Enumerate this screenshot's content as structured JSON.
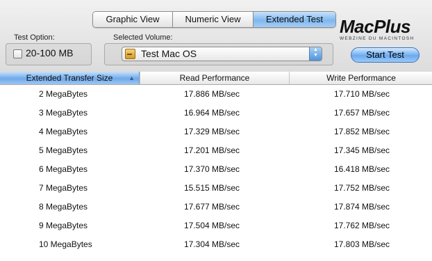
{
  "tabs": [
    {
      "label": "Graphic View",
      "active": false
    },
    {
      "label": "Numeric View",
      "active": false
    },
    {
      "label": "Extended Test",
      "active": true
    }
  ],
  "test_option": {
    "label": "Test Option:",
    "checkbox_label": "20-100 MB",
    "checked": false
  },
  "volume": {
    "label": "Selected Volume:",
    "selected": "Test Mac OS"
  },
  "logo": {
    "main": "MacPlus",
    "sub": "WEBZINE DU MACINTOSH"
  },
  "start_button": "Start Test",
  "table": {
    "headers": [
      "Extended Transfer Size",
      "Read Performance",
      "Write Performance"
    ],
    "rows": [
      [
        "2 MegaBytes",
        "17.886 MB/sec",
        "17.710 MB/sec"
      ],
      [
        "3 MegaBytes",
        "16.964 MB/sec",
        "17.657 MB/sec"
      ],
      [
        "4 MegaBytes",
        "17.329 MB/sec",
        "17.852 MB/sec"
      ],
      [
        "5 MegaBytes",
        "17.201 MB/sec",
        "17.345 MB/sec"
      ],
      [
        "6 MegaBytes",
        "17.370 MB/sec",
        "16.418 MB/sec"
      ],
      [
        "7 MegaBytes",
        "15.515 MB/sec",
        "17.752 MB/sec"
      ],
      [
        "8 MegaBytes",
        "17.677 MB/sec",
        "17.874 MB/sec"
      ],
      [
        "9 MegaBytes",
        "17.504 MB/sec",
        "17.762 MB/sec"
      ],
      [
        "10 MegaBytes",
        "17.304 MB/sec",
        "17.803 MB/sec"
      ]
    ]
  },
  "colors": {
    "accent": "#7fb7ee",
    "selected_header": "#6ea9ea"
  }
}
